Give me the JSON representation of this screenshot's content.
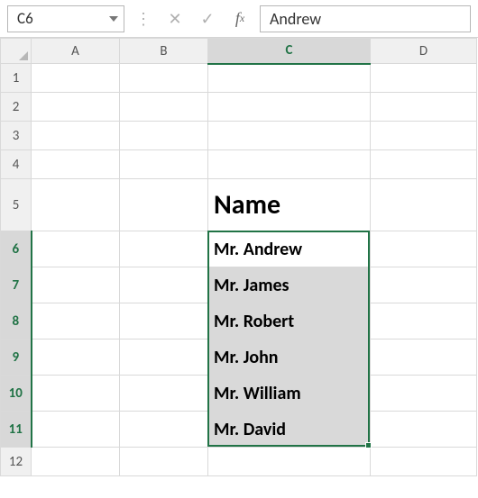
{
  "nameBox": {
    "value": "C6"
  },
  "formulaBar": {
    "value": "Andrew"
  },
  "columns": [
    "A",
    "B",
    "C",
    "D"
  ],
  "rows": [
    "1",
    "2",
    "3",
    "4",
    "5",
    "6",
    "7",
    "8",
    "9",
    "10",
    "11",
    "12"
  ],
  "activeColumn": "C",
  "activeRows": [
    "6",
    "7",
    "8",
    "9",
    "10",
    "11"
  ],
  "cells": {
    "C5": "Name",
    "C6": "Mr. Andrew",
    "C7": "Mr. James",
    "C8": "Mr. Robert",
    "C9": "Mr. John",
    "C10": "Mr. William",
    "C11": "Mr. David"
  },
  "colWidths": {
    "A": 98,
    "B": 98,
    "C": 180,
    "D": 118
  }
}
